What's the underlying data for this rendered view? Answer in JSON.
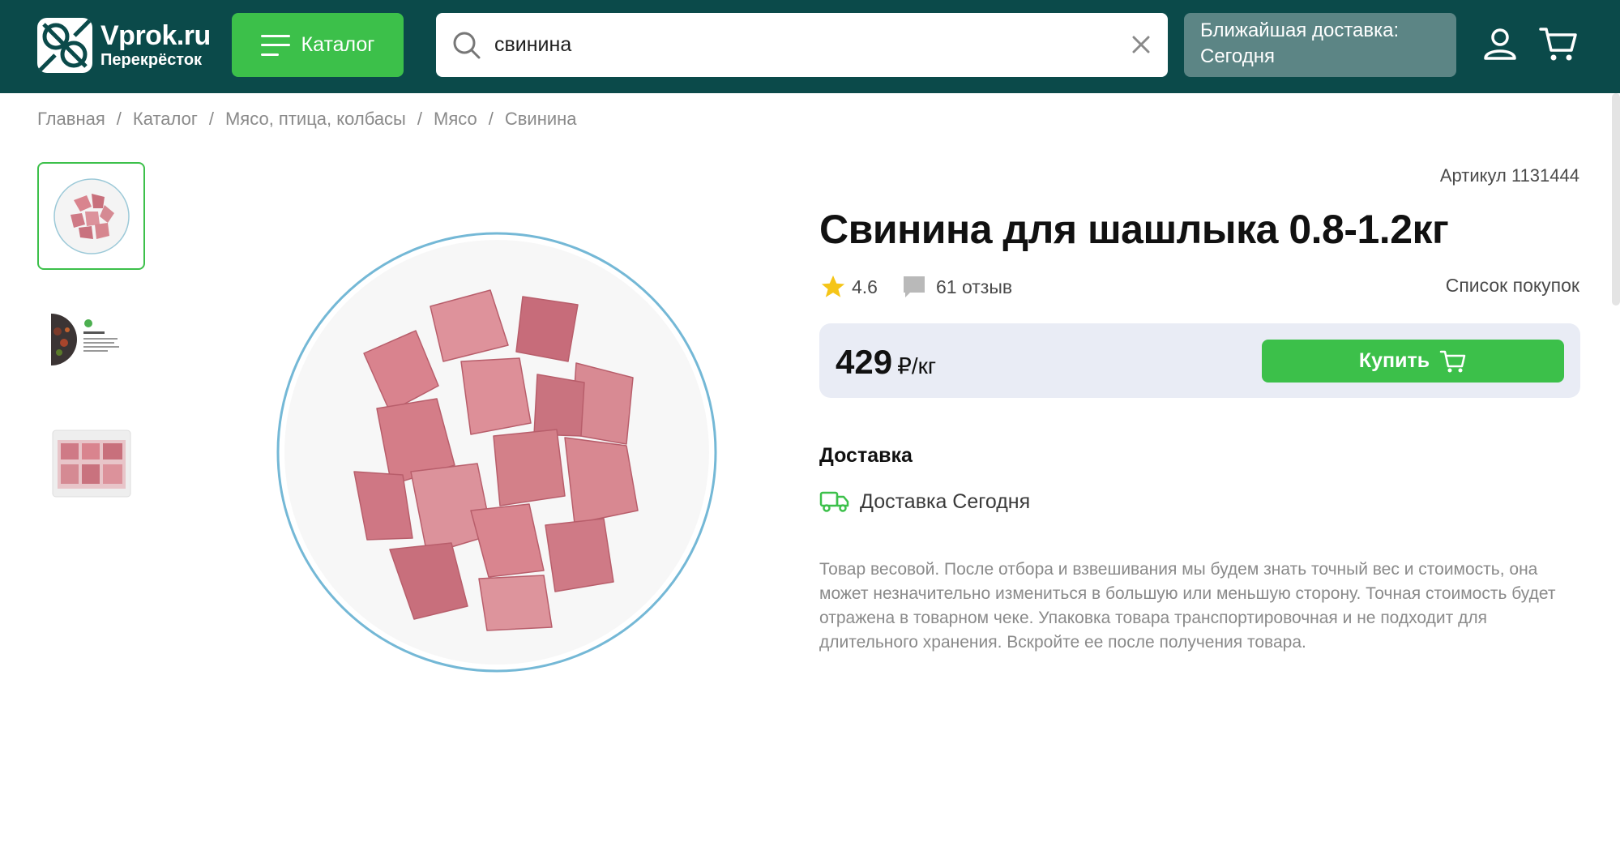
{
  "header": {
    "logo_title": "Vprok.ru",
    "logo_subtitle": "Перекрёсток",
    "catalog_label": "Каталог",
    "search_value": "свинина",
    "delivery_line1": "Ближайшая доставка:",
    "delivery_line2": "Сегодня"
  },
  "breadcrumb": [
    "Главная",
    "Каталог",
    "Мясо, птица, колбасы",
    "Мясо",
    "Свинина"
  ],
  "product": {
    "sku": "Артикул 1131444",
    "title": "Свинина для шашлыка 0.8-1.2кг",
    "rating": "4.6",
    "reviews": "61 отзыв",
    "shopping_list": "Список покупок",
    "price": "429",
    "price_unit": "₽/кг",
    "buy_label": "Купить",
    "delivery_heading": "Доставка",
    "delivery_text": "Доставка Сегодня",
    "description": "Товар весовой. После отбора и взвешивания мы будем знать точный вес и стоимость, она может незначительно измениться в большую или меньшую сторону. Точная стоимость будет отражена в товарном чеке. Упаковка товара транспортировочная и не подходит для длительного хранения. Вскройте ее после получения товара."
  },
  "colors": {
    "header_bg": "#0b4a4a",
    "accent_green": "#3cc04a",
    "delivery_box": "#5c8585",
    "price_box": "#e9ecf5",
    "star": "#f5c518"
  }
}
